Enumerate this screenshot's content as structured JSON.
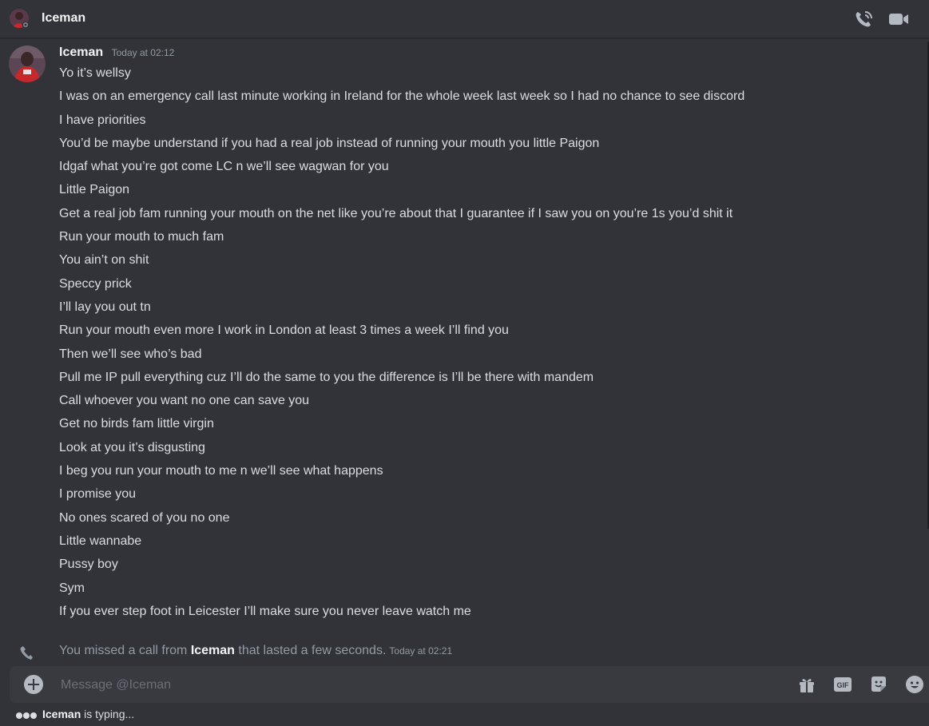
{
  "header": {
    "title": "Iceman",
    "actions": [
      "start-voice-call-icon",
      "start-video-call-icon"
    ]
  },
  "message": {
    "author": "Iceman",
    "timestamp": "Today at 02:12",
    "lines": [
      "Yo it’s wellsy",
      "I was on an emergency call last minute working in Ireland for the whole week last week so I had no chance to see discord",
      "I have priorities",
      "You’d be maybe understand if you had a real job instead of running your mouth you little Paigon",
      "Idgaf what you’re got come LC n we’ll see wagwan for you",
      "Little Paigon",
      "Get a real job fam running your mouth on the net like you’re about that I guarantee if I saw you on you’re 1s you’d shit it",
      "Run your mouth to much fam",
      "You ain’t on shit",
      "Speccy prick",
      "I’ll lay you out tn",
      "Run your mouth even more I work in London at least 3 times a week I’ll find you",
      "Then we’ll see who’s bad",
      "Pull me IP pull everything cuz I’ll do the same to you the difference is I’ll be there with mandem",
      "Call whoever you want no one can save you",
      "Get no birds fam little virgin",
      "Look at you it’s disgusting",
      "I beg you run your mouth to me n we’ll see what happens",
      "I promise you",
      "No ones scared of you no one",
      "Little wannabe",
      "Pussy boy",
      "Sym",
      "If you ever step foot in Leicester I’ll make sure you never leave watch me"
    ]
  },
  "system_message": {
    "prefix": "You missed a call from ",
    "name": "Iceman",
    "suffix": " that lasted a few seconds.",
    "timestamp": "Today at 02:21"
  },
  "composer": {
    "placeholder": "Message @Iceman",
    "tools": [
      "gift-icon",
      "gif-icon",
      "sticker-icon",
      "emoji-icon"
    ]
  },
  "typing": {
    "name": "Iceman",
    "text": " is typing..."
  },
  "colors": {
    "background": "#313338",
    "composer": "#383a40",
    "text": "#dbdee1",
    "muted": "#949ba4",
    "avatar_red": "#c7282b"
  }
}
